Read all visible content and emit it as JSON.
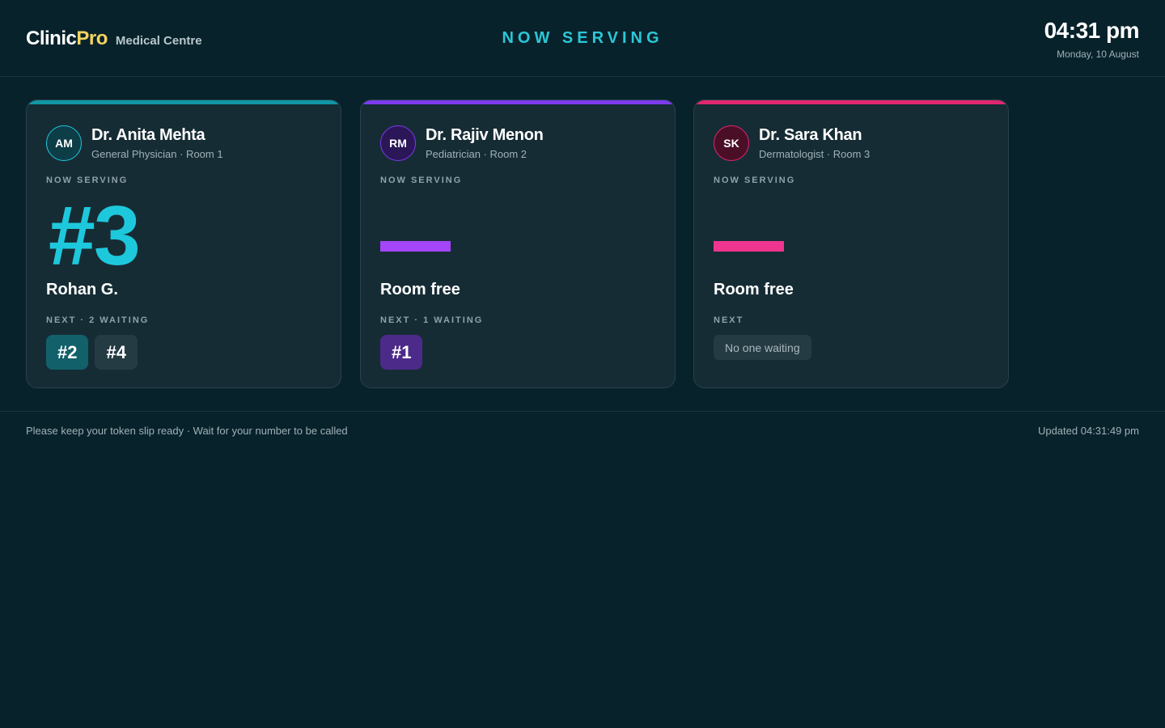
{
  "brand": {
    "name_a": "Clinic",
    "name_b": "Pro",
    "subtitle": "Medical Centre"
  },
  "header": {
    "headline": "NOW SERVING"
  },
  "clock": {
    "time": "04:31 pm",
    "date": "Monday, 10 August"
  },
  "colors": {
    "background": "#08222b",
    "card": "#162c35",
    "teal": "#1ec8dc",
    "purple": "#a445f7",
    "pink": "#f0358f",
    "brand_accent": "#f4d35e"
  },
  "cards": [
    {
      "initials": "AM",
      "doctor": "Dr. Anita Mehta",
      "role": "General Physician · Room 1",
      "now_label": "NOW SERVING",
      "token": "#3",
      "patient": "Rohan G.",
      "next_label": "NEXT · 2 WAITING",
      "next_tokens": [
        "#2",
        "#4"
      ]
    },
    {
      "initials": "RM",
      "doctor": "Dr. Rajiv Menon",
      "role": "Pediatrician · Room 2",
      "now_label": "NOW SERVING",
      "status": "Room free",
      "next_label": "NEXT · 1 WAITING",
      "next_tokens": [
        "#1"
      ]
    },
    {
      "initials": "SK",
      "doctor": "Dr. Sara Khan",
      "role": "Dermatologist · Room 3",
      "now_label": "NOW SERVING",
      "status": "Room free",
      "next_label": "NEXT",
      "empty_text": "No one waiting"
    }
  ],
  "footer": {
    "note": "Please keep your token slip ready · Wait for your number to be called",
    "updated": "Updated 04:31:49 pm"
  }
}
